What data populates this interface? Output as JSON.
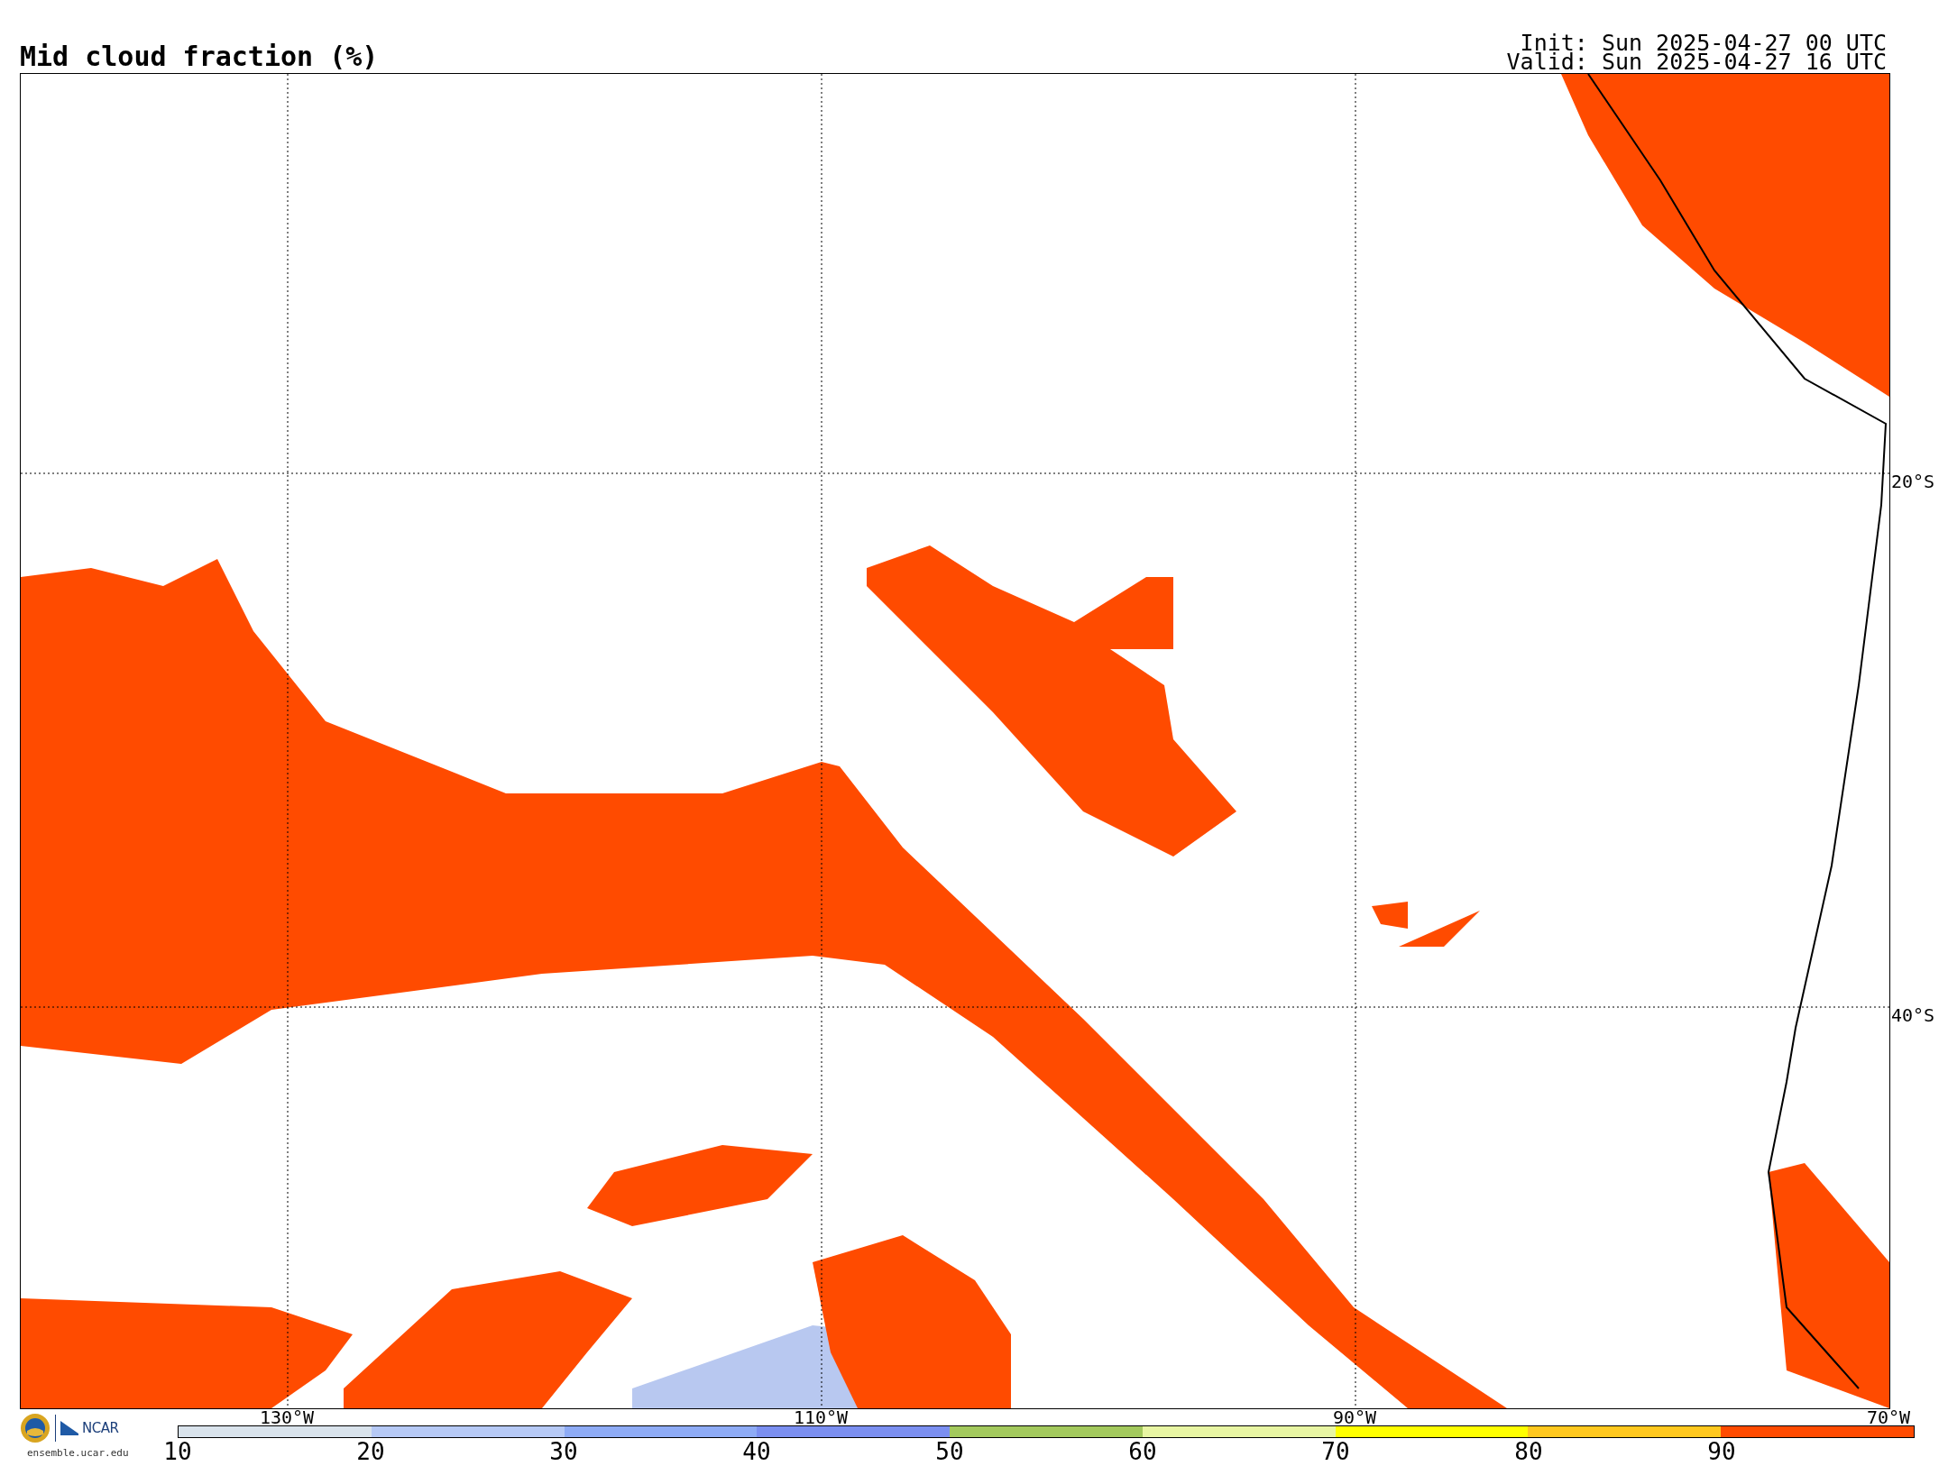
{
  "title": "Mid cloud fraction (%)",
  "run_times": [
    "Init: Sun 2025-04-27 00 UTC",
    "Valid: Sun 2025-04-27 16 UTC"
  ],
  "map": {
    "longitude_labels": [
      "130°W",
      "110°W",
      "90°W",
      "70°W"
    ],
    "latitude_labels": [
      "20°S",
      "40°S"
    ]
  },
  "colorbar": {
    "bins": [
      {
        "color": "#d9e3ec"
      },
      {
        "color": "#b6c9f5"
      },
      {
        "color": "#8eabf5"
      },
      {
        "color": "#7b8ff0"
      },
      {
        "color": "#a3c95d"
      },
      {
        "color": "#e8f5a3"
      },
      {
        "color": "#ffff00"
      },
      {
        "color": "#ffc81e"
      },
      {
        "color": "#ff4b00"
      }
    ],
    "ticks": [
      "10",
      "20",
      "30",
      "40",
      "50",
      "60",
      "70",
      "80",
      "90"
    ]
  },
  "footer": {
    "logo_text": "NCAR",
    "url": "ensemble.ucar.edu"
  }
}
